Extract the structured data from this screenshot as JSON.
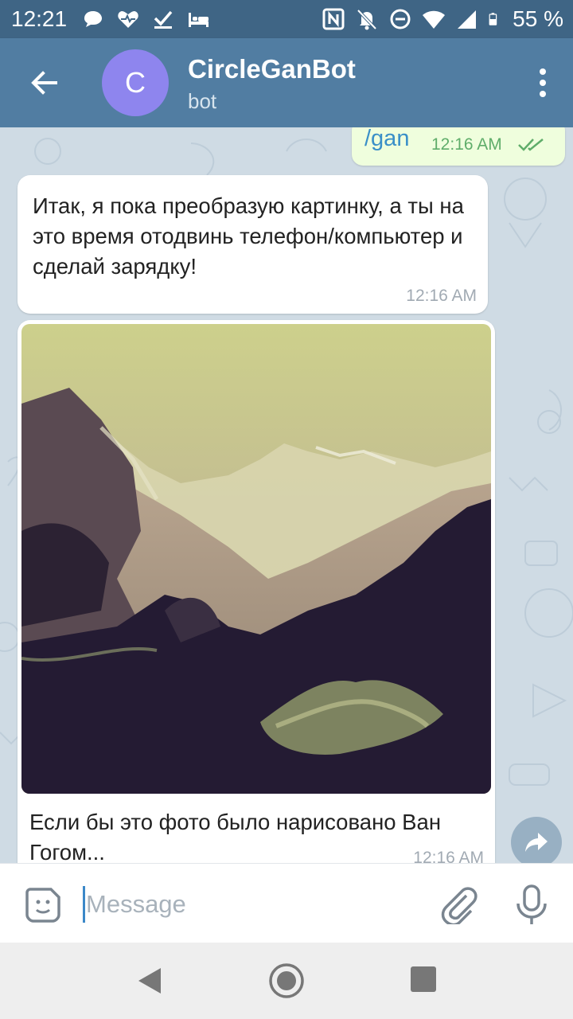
{
  "status_bar": {
    "time": "12:21",
    "battery_percent": "55 %",
    "left_icons": [
      "chat-bubble-icon",
      "heart-pulse-icon",
      "checkmark-icon",
      "bed-icon"
    ],
    "right_icons": [
      "nfc-icon",
      "bell-off-icon",
      "do-not-disturb-icon",
      "wifi-icon",
      "signal-icon",
      "battery-icon"
    ]
  },
  "header": {
    "avatar_letter": "C",
    "avatar_color": "#8e85ee",
    "title": "CircleGanBot",
    "subtitle": "bot"
  },
  "messages": {
    "outgoing": {
      "text": "/gan",
      "time": "12:16 AM",
      "status": "read"
    },
    "incoming_text": {
      "text": "Итак, я пока преобразую картинку, а ты на это время отодвинь телефон/компьютер и сделай зарядку!",
      "time": "12:16 AM"
    },
    "incoming_photo": {
      "caption": "Если бы это фото было нарисовано Ван Гогом...",
      "time": "12:16 AM"
    }
  },
  "input": {
    "placeholder": "Message"
  },
  "colors": {
    "header": "#517da2",
    "status_bar": "#3f6585",
    "chat_background": "#cfdbe4",
    "outgoing_bubble": "#effedd",
    "link": "#3a8fc8"
  }
}
